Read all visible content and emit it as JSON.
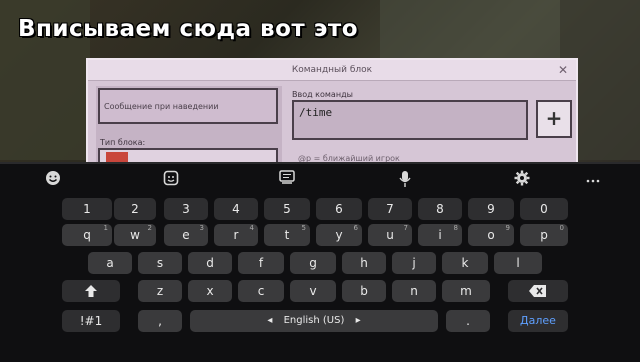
{
  "caption": "Вписываем сюда вот это",
  "dialog": {
    "title": "Командный блок",
    "close": "✕",
    "hover_placeholder": "Сообщение при наведении",
    "block_type_label": "Тип блока:",
    "command_label": "Ввод команды",
    "command_value": "/time",
    "plus": "+",
    "hint": "@p = ближайший игрок"
  },
  "keyboard": {
    "toolbar": [
      "emoji-icon",
      "sticker-icon",
      "clipboard-icon",
      "mic-icon",
      "gear-icon",
      "more-icon"
    ],
    "numbers": [
      "1",
      "2",
      "3",
      "4",
      "5",
      "6",
      "7",
      "8",
      "9",
      "0"
    ],
    "row1": [
      "q",
      "w",
      "e",
      "r",
      "t",
      "y",
      "u",
      "i",
      "o",
      "p"
    ],
    "row1_hints": [
      "1",
      "2",
      "3",
      "4",
      "5",
      "6",
      "7",
      "8",
      "9",
      "0"
    ],
    "row2": [
      "a",
      "s",
      "d",
      "f",
      "g",
      "h",
      "j",
      "k",
      "l"
    ],
    "row3": [
      "z",
      "x",
      "c",
      "v",
      "b",
      "n",
      "m"
    ],
    "symbols_label": "!#1",
    "comma": ",",
    "space_label": "English (US)",
    "space_left_arrow": "◂",
    "space_right_arrow": "▸",
    "period": ".",
    "enter_label": "Далее",
    "shift": "🡅",
    "backspace": "⌫"
  }
}
